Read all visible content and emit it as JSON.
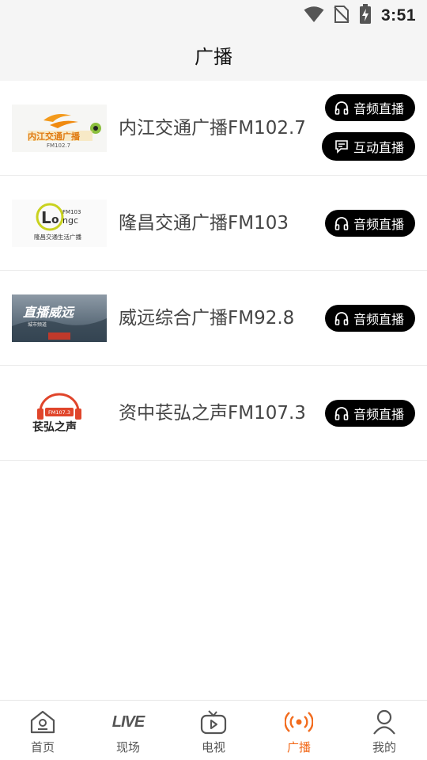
{
  "status_bar": {
    "time": "3:51"
  },
  "header": {
    "title": "广播"
  },
  "stations": [
    {
      "name": "内江交通广播FM102.7",
      "logo_text": "内江交通广播",
      "logo_sub": "FM102.7",
      "buttons": [
        {
          "label": "音频直播",
          "icon": "headphones-icon"
        },
        {
          "label": "互动直播",
          "icon": "chat-icon"
        }
      ]
    },
    {
      "name": "隆昌交通广播FM103",
      "logo_text": "隆昌交通生活广播",
      "logo_sub": "FM103",
      "buttons": [
        {
          "label": "音频直播",
          "icon": "headphones-icon"
        }
      ]
    },
    {
      "name": "威远综合广播FM92.8",
      "logo_text": "直播威远",
      "logo_sub": "城市频道",
      "buttons": [
        {
          "label": "音频直播",
          "icon": "headphones-icon"
        }
      ]
    },
    {
      "name": "资中苌弘之声FM107.3",
      "logo_text": "苌弘之声",
      "logo_sub": "FM107.3",
      "buttons": [
        {
          "label": "音频直播",
          "icon": "headphones-icon"
        }
      ]
    }
  ],
  "tabbar": {
    "items": [
      {
        "label": "首页",
        "icon": "home-icon",
        "active": false
      },
      {
        "label": "现场",
        "icon": "live-icon",
        "icon_text": "LIVE",
        "active": false
      },
      {
        "label": "电视",
        "icon": "tv-icon",
        "active": false
      },
      {
        "label": "广播",
        "icon": "radio-icon",
        "active": true
      },
      {
        "label": "我的",
        "icon": "user-icon",
        "active": false
      }
    ]
  },
  "colors": {
    "accent": "#f26b1d",
    "button_bg": "#000000",
    "header_bg": "#f5f5f5"
  }
}
